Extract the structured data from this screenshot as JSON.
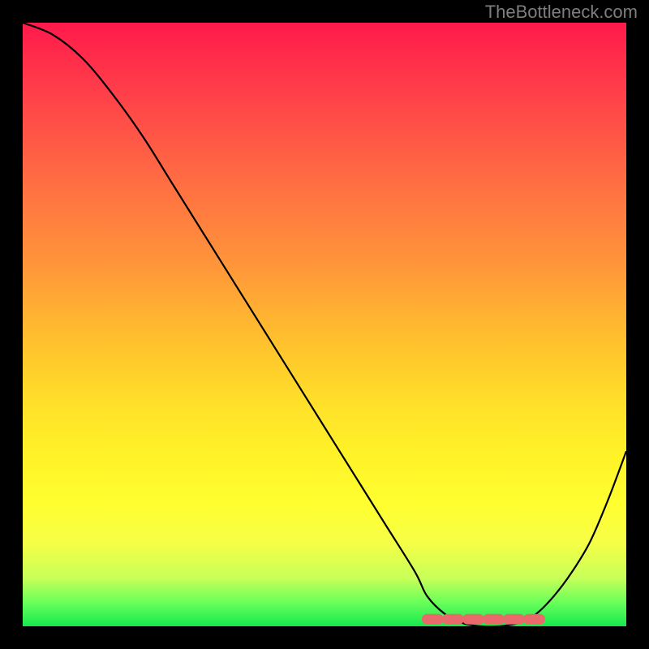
{
  "attribution": "TheBottleneck.com",
  "chart_data": {
    "type": "line",
    "title": "",
    "xlabel": "",
    "ylabel": "",
    "xlim": [
      0,
      100
    ],
    "ylim": [
      0,
      100
    ],
    "x": [
      0,
      5,
      10,
      15,
      20,
      25,
      30,
      35,
      40,
      45,
      50,
      55,
      60,
      65,
      67,
      70,
      73,
      76,
      79,
      82,
      85,
      88,
      91,
      94,
      97,
      100
    ],
    "y": [
      100,
      98,
      94,
      88,
      81,
      73,
      65,
      57,
      49,
      41,
      33,
      25,
      17,
      9,
      5,
      2,
      0.5,
      0,
      0,
      0.5,
      2,
      5,
      9,
      14,
      21,
      29
    ],
    "flat_region": {
      "x_start": 67,
      "x_end": 86,
      "y": 0.5
    },
    "background_gradient": {
      "top": "#ff1a4b",
      "mid": "#ffe229",
      "bottom": "#15e94e"
    }
  }
}
